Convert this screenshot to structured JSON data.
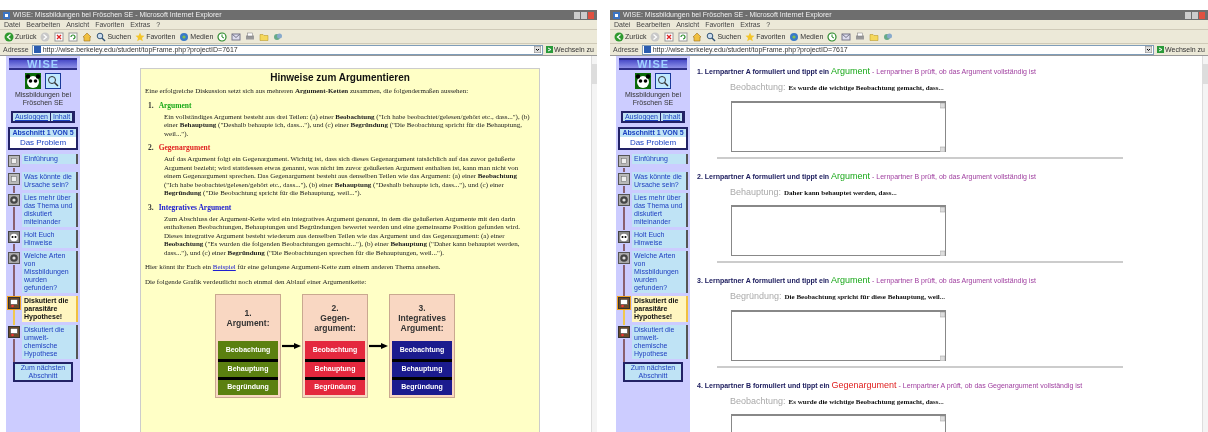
{
  "windows": [
    {
      "title": "WISE: Missbildungen bei Fröschen SE - Microsoft Internet Explorer",
      "menu": [
        "Datei",
        "Bearbeiten",
        "Ansicht",
        "Favoriten",
        "Extras",
        "?"
      ],
      "toolbar": [
        {
          "kind": "back",
          "label": "Zurück"
        },
        {
          "kind": "forward"
        },
        {
          "kind": "stop"
        },
        {
          "kind": "refresh"
        },
        {
          "kind": "home"
        },
        {
          "kind": "search",
          "label": "Suchen"
        },
        {
          "kind": "favorites",
          "label": "Favoriten"
        },
        {
          "kind": "media",
          "label": "Medien"
        },
        {
          "kind": "history"
        },
        {
          "kind": "mail"
        },
        {
          "kind": "print"
        },
        {
          "kind": "folder"
        },
        {
          "kind": "messenger"
        }
      ],
      "address_label": "Adresse",
      "url": "http://wise.berkeley.edu/student/topFrame.php?projectID=7617",
      "go_label": "Wechseln zu",
      "sidebar": {
        "logo": "WISE",
        "project": "Missbildungen bei Fröschen SE",
        "buttons": [
          "Ausloggen",
          "Inhalt"
        ],
        "section_label": "Abschnitt 1 VON 5",
        "section_title": "Das Problem",
        "steps": [
          {
            "label": "Einführung",
            "kind": "page",
            "selected": false
          },
          {
            "label": "Was könnte die Ursache sein?",
            "kind": "page",
            "selected": false
          },
          {
            "label": "Lies mehr über das Thema und diskutiert miteinander",
            "kind": "discussion",
            "selected": false
          },
          {
            "label": "Holt Euch Hinweise",
            "kind": "hint",
            "selected": false
          },
          {
            "label": "Welche Arten von Missbildungen wurden gefunden?",
            "kind": "discussion",
            "selected": false
          },
          {
            "label": "Diskutiert die parasitäre Hypothese!",
            "kind": "debate",
            "selected": true
          },
          {
            "label": "Diskutiert die umwelt-chemische Hypothese",
            "kind": "debate",
            "selected": false
          }
        ],
        "next_button": "Zum nächsten Abschnitt"
      },
      "content": {
        "kind": "hints",
        "title": "Hinweise zum Argumentieren",
        "intro": "Eine erfolgreiche Diskussion setzt sich aus mehreren **Argument-Ketten** zusammen, die folgendermaßen aussehen:",
        "items": [
          {
            "number": "1.",
            "title": "Argument",
            "kind": "argument",
            "text": "Ein vollständiges Argument besteht aus drei Teilen: (a) einer **Beobachtung** (\"Ich habe beobachtet/gelesen/gehört etc., dass...\"), (b) einer **Behauptung** (\"Deshalb behaupte ich, dass...\"), und (c) einer **Begründung** (\"Die Beobachtung spricht für die Behauptung, weil...\")."
          },
          {
            "number": "2.",
            "title": "Gegenargument",
            "kind": "counter",
            "text": "Auf das Argument folgt ein Gegenargument. Wichtig ist, dass sich dieses Gegenargument tatsächlich auf das zuvor geäußerte Argument bezieht; wird stattdessen etwas genannt, was nicht im zuvor geäußerten Argument enthalten ist, kann man nicht von einem Gegenargument sprechen. Das Gegenargument besteht aus denselben Teilen wie das Argument: (a) einer **Beobachtung** (\"Ich habe beobachtet/gelesen/gehört etc., dass...\"), (b) einer **Behauptung** (\"Deshalb behaupte ich, dass...\"), und (c) einer **Begründung** (\"Die Beobachtung spricht für die Behauptung, weil...\")."
          },
          {
            "number": "3.",
            "title": "Integratives Argument",
            "kind": "integrative",
            "text": "Zum Abschluss der Argument-Kette wird ein integratives Argument genannt, in dem die geäußerten Argumente mit den darin enthaltenen Beobachtungen, Behauptungen und Begründungen bewertet werden und eine gemeinsame Position gefunden wird. Dieses integrative Argument besteht wiederum aus denselben Teilen wie das Argument und das Gegenargument: (a) einer **Beobachtung** (\"Es wurden die folgenden Beobachtungen gemacht...\"), (b) einer **Behauptung** (\"Daher kann behauptet werden, dass...\"), und (c) einer **Begründung** (\"Die Beobachtungen sprechen für die Behauptungen, weil...\")."
          }
        ],
        "example_before": "Hier könnt ihr Euch ein",
        "example_link": "Beispiel",
        "example_after": "für eine gelungene Argument-Kette zum einem anderen Thema ansehen.",
        "diagram_caption": "Die folgende Grafik verdeutlicht noch einmal den Ablauf einer Argumentkette:",
        "diagram": [
          {
            "number": "1.",
            "title": "Argument:",
            "color": "#5b8010",
            "parts": [
              "Beobachtung",
              "Behauptung",
              "Begründung"
            ]
          },
          {
            "number": "2.",
            "title": "Gegen-argument:",
            "color": "#e4283e",
            "parts": [
              "Beobachtung",
              "Behauptung",
              "Begründung"
            ]
          },
          {
            "number": "3.",
            "title": "Integratives Argument:",
            "color": "#1b1b8e",
            "parts": [
              "Beobachtung",
              "Behauptung",
              "Begründung"
            ]
          }
        ]
      }
    },
    {
      "title": "WISE: Missbildungen bei Fröschen SE - Microsoft Internet Explorer",
      "menu": [
        "Datei",
        "Bearbeiten",
        "Ansicht",
        "Favoriten",
        "Extras",
        "?"
      ],
      "toolbar": [
        {
          "kind": "back",
          "label": "Zurück"
        },
        {
          "kind": "forward"
        },
        {
          "kind": "stop"
        },
        {
          "kind": "refresh"
        },
        {
          "kind": "home"
        },
        {
          "kind": "search",
          "label": "Suchen"
        },
        {
          "kind": "favorites",
          "label": "Favoriten"
        },
        {
          "kind": "media",
          "label": "Medien"
        },
        {
          "kind": "history"
        },
        {
          "kind": "mail"
        },
        {
          "kind": "print"
        },
        {
          "kind": "folder"
        },
        {
          "kind": "messenger"
        }
      ],
      "address_label": "Adresse",
      "url": "http://wise.berkeley.edu/student/topFrame.php?projectID=7617",
      "go_label": "Wechseln zu",
      "sidebar": {
        "logo": "WISE",
        "project": "Missbildungen bei Fröschen SE",
        "buttons": [
          "Ausloggen",
          "Inhalt"
        ],
        "section_label": "Abschnitt 1 VON 5",
        "section_title": "Das Problem",
        "steps": [
          {
            "label": "Einführung",
            "kind": "page",
            "selected": false
          },
          {
            "label": "Was könnte die Ursache sein?",
            "kind": "page",
            "selected": false
          },
          {
            "label": "Lies mehr über das Thema und diskutiert miteinander",
            "kind": "discussion",
            "selected": false
          },
          {
            "label": "Holt Euch Hinweise",
            "kind": "hint",
            "selected": false
          },
          {
            "label": "Welche Arten von Missbildungen wurden gefunden?",
            "kind": "discussion",
            "selected": false
          },
          {
            "label": "Diskutiert die parasitäre Hypothese!",
            "kind": "debate",
            "selected": true
          },
          {
            "label": "Diskutiert die umwelt-chemische Hypothese",
            "kind": "debate",
            "selected": false
          }
        ],
        "next_button": "Zum nächsten Abschnitt"
      },
      "content": {
        "kind": "form",
        "sections": [
          {
            "lead": "1. Lernpartner A formuliert und tippt ein",
            "keyword": "Argument",
            "kind": "argument",
            "check": "- Lernpartner B prüft, ob das Argument vollständig ist",
            "field_label": "Beobachtung:",
            "prompt": "Es wurde die wichtige Beobachtung gemacht, dass..."
          },
          {
            "lead": "2. Lernpartner A formuliert und tippt ein",
            "keyword": "Argument",
            "kind": "argument",
            "check": "- Lernpartner B prüft, ob das Argument vollständig ist",
            "field_label": "Behauptung:",
            "prompt": "Daher kann behauptet werden, dass..."
          },
          {
            "lead": "3. Lernpartner A formuliert und tippt ein",
            "keyword": "Argument",
            "kind": "argument",
            "check": "- Lernpartner B prüft, ob das Argument vollständig ist",
            "field_label": "Begründung:",
            "prompt": "Die Beobachtung spricht für diese Behauptung, weil..."
          },
          {
            "lead": "4. Lernpartner B formuliert und tippt ein",
            "keyword": "Gegenargument",
            "kind": "counter",
            "check": "- Lernpartner A prüft, ob das Gegenargument vollständig ist",
            "field_label": "Beobachtung:",
            "prompt": "Es wurde die wichtige Beobachtung gemacht, dass..."
          }
        ]
      }
    }
  ]
}
